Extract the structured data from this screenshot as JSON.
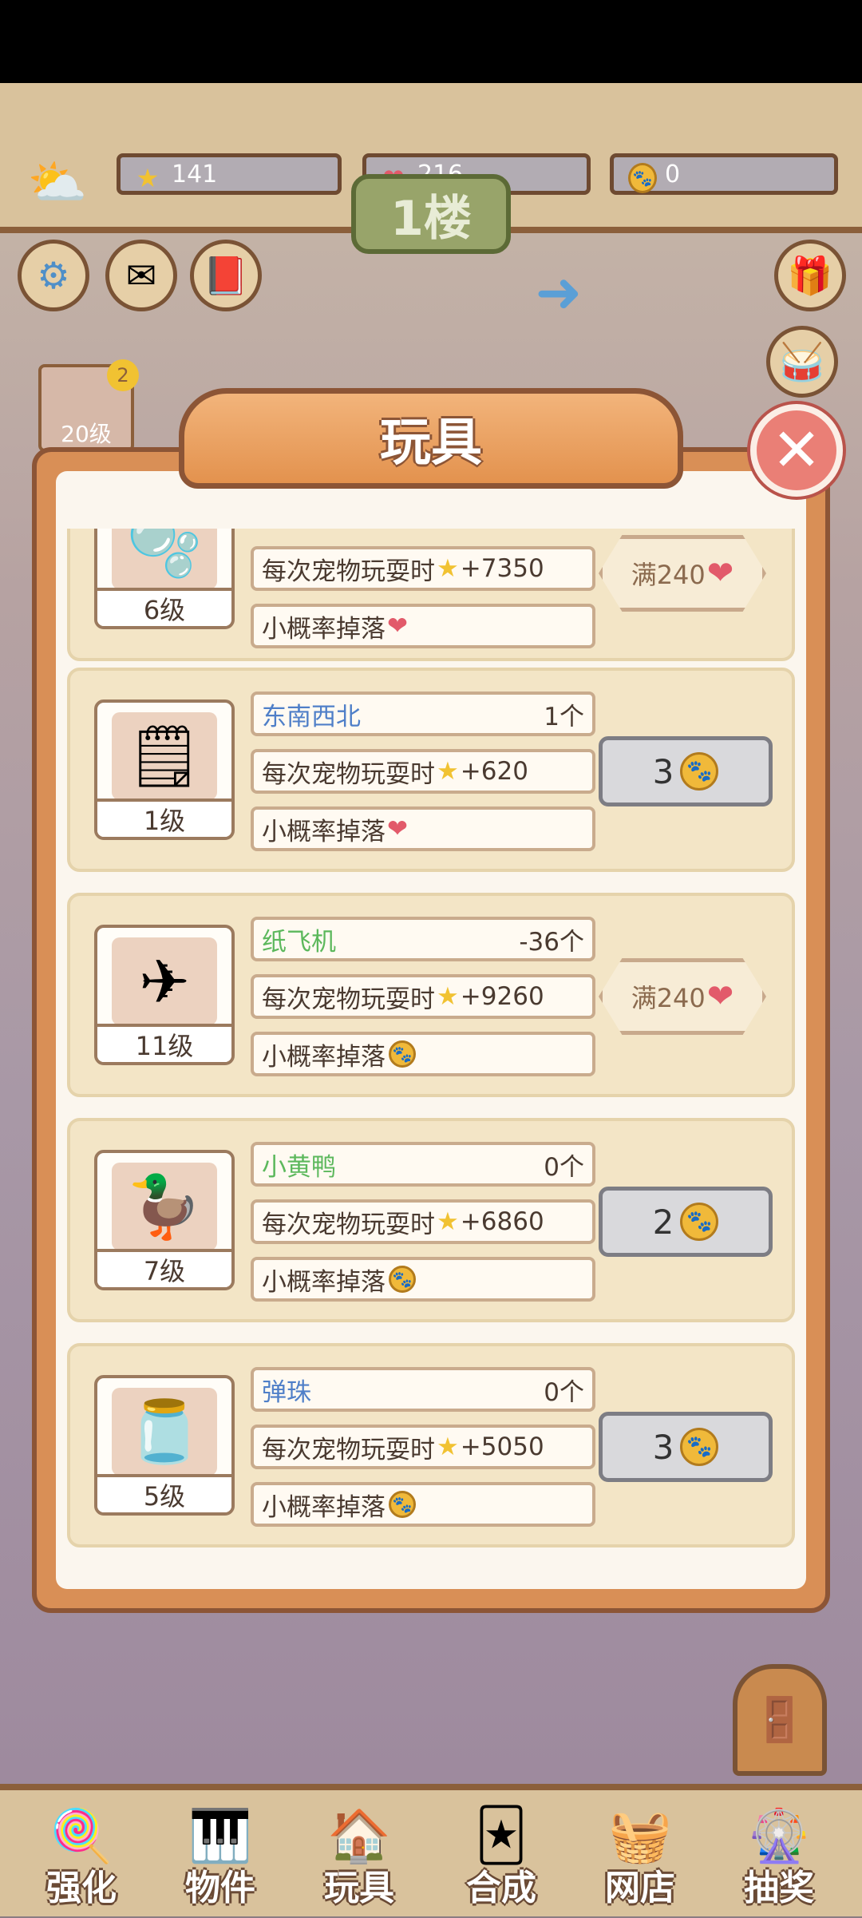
{
  "resources": {
    "stars": "141",
    "hearts": "216",
    "coins": "0"
  },
  "floor_sign": "1楼",
  "avatar": {
    "level": "20级",
    "badge": "2"
  },
  "modal": {
    "title": "玩具",
    "close_icon": "close-icon",
    "items": [
      {
        "name": "",
        "count": "",
        "level": "6级",
        "play_bonus_label": "每次宠物玩耍时",
        "play_bonus_value": "+7350",
        "drop_label": "小概率掉落",
        "drop_icon": "heart",
        "status": "full",
        "full_label": "满240"
      },
      {
        "name": "东南西北",
        "name_color": "#4f7fc8",
        "count": "1个",
        "level": "1级",
        "icon": "🗒",
        "play_bonus_label": "每次宠物玩耍时",
        "play_bonus_value": "+620",
        "drop_label": "小概率掉落",
        "drop_icon": "heart",
        "status": "buy",
        "price": "3"
      },
      {
        "name": "纸飞机",
        "name_color": "#5cb85c",
        "count": "-36个",
        "level": "11级",
        "icon": "✈",
        "play_bonus_label": "每次宠物玩耍时",
        "play_bonus_value": "+9260",
        "drop_label": "小概率掉落",
        "drop_icon": "coin",
        "status": "full",
        "full_label": "满240"
      },
      {
        "name": "小黄鸭",
        "name_color": "#5cb85c",
        "count": "0个",
        "level": "7级",
        "icon": "🦆",
        "play_bonus_label": "每次宠物玩耍时",
        "play_bonus_value": "+6860",
        "drop_label": "小概率掉落",
        "drop_icon": "coin",
        "status": "buy",
        "price": "2"
      },
      {
        "name": "弹珠",
        "name_color": "#4f7fc8",
        "count": "0个",
        "level": "5级",
        "icon": "🫙",
        "play_bonus_label": "每次宠物玩耍时",
        "play_bonus_value": "+5050",
        "drop_label": "小概率掉落",
        "drop_icon": "coin",
        "status": "buy",
        "price": "3"
      }
    ]
  },
  "bottom_nav": [
    {
      "label": "强化",
      "icon": "lollipop-icon"
    },
    {
      "label": "物件",
      "icon": "piano-icon"
    },
    {
      "label": "玩具",
      "icon": "toy-house-icon"
    },
    {
      "label": "合成",
      "icon": "cards-icon"
    },
    {
      "label": "网店",
      "icon": "basket-icon"
    },
    {
      "label": "抽奖",
      "icon": "wheel-icon"
    }
  ],
  "colors": {
    "modal_orange": "#d98f56",
    "card_bg": "#f3e5c6",
    "accent_brown": "#8c5536"
  }
}
